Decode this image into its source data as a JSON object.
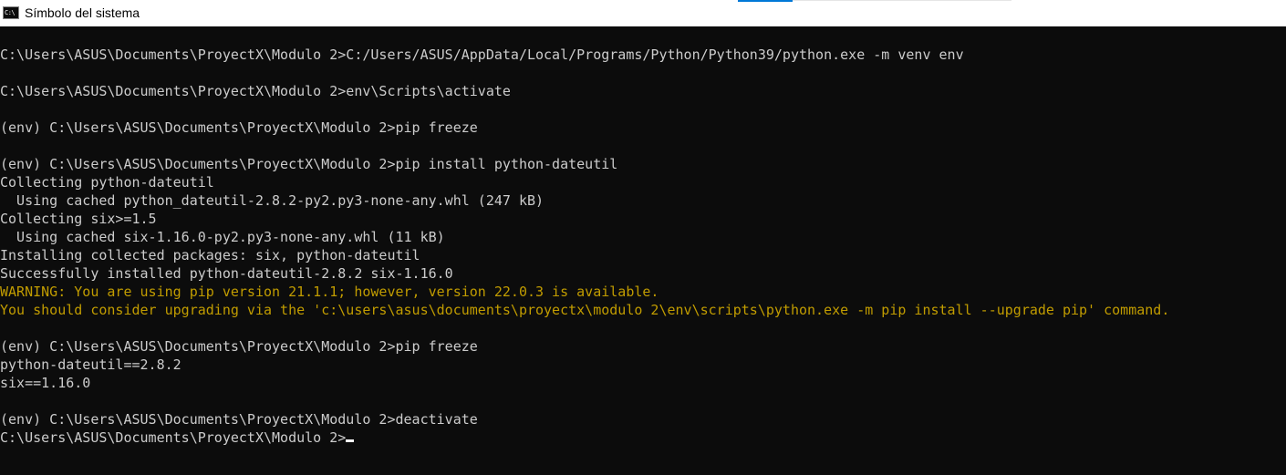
{
  "window": {
    "title": "Símbolo del sistema",
    "icon": "cmd-icon",
    "icon_glyph": "C:\\"
  },
  "colors": {
    "background": "#0c0c0c",
    "text": "#cccccc",
    "warning": "#c19c00",
    "cursor": "#ffffff"
  },
  "console": {
    "lines": [
      "C:\\Users\\ASUS\\Documents\\ProyectX\\Modulo 2>C:/Users/ASUS/AppData/Local/Programs/Python/Python39/python.exe -m venv env",
      "C:\\Users\\ASUS\\Documents\\ProyectX\\Modulo 2>env\\Scripts\\activate",
      "(env) C:\\Users\\ASUS\\Documents\\ProyectX\\Modulo 2>pip freeze",
      "(env) C:\\Users\\ASUS\\Documents\\ProyectX\\Modulo 2>pip install python-dateutil",
      "Collecting python-dateutil",
      "  Using cached python_dateutil-2.8.2-py2.py3-none-any.whl (247 kB)",
      "Collecting six>=1.5",
      "  Using cached six-1.16.0-py2.py3-none-any.whl (11 kB)",
      "Installing collected packages: six, python-dateutil",
      "Successfully installed python-dateutil-2.8.2 six-1.16.0",
      "WARNING: You are using pip version 21.1.1; however, version 22.0.3 is available.",
      "You should consider upgrading via the 'c:\\users\\asus\\documents\\proyectx\\modulo 2\\env\\scripts\\python.exe -m pip install --upgrade pip' command.",
      "(env) C:\\Users\\ASUS\\Documents\\ProyectX\\Modulo 2>pip freeze",
      "python-dateutil==2.8.2",
      "six==1.16.0",
      "(env) C:\\Users\\ASUS\\Documents\\ProyectX\\Modulo 2>deactivate",
      "C:\\Users\\ASUS\\Documents\\ProyectX\\Modulo 2>"
    ]
  }
}
